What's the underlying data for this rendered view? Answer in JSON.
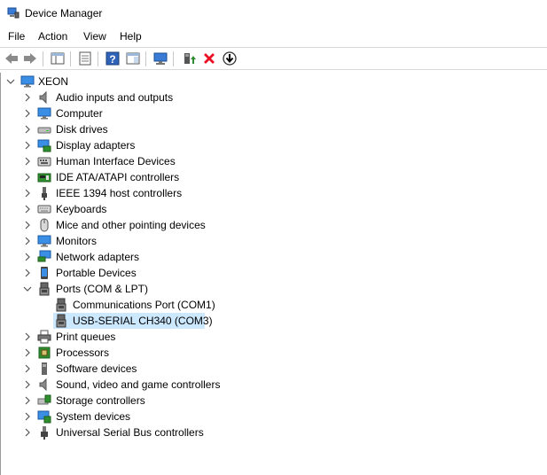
{
  "window": {
    "title": "Device Manager"
  },
  "menu": [
    "File",
    "Action",
    "View",
    "Help"
  ],
  "tree": {
    "root": "XEON",
    "categories": [
      {
        "label": "Audio inputs and outputs",
        "icon": "speaker-icon"
      },
      {
        "label": "Computer",
        "icon": "monitor-icon"
      },
      {
        "label": "Disk drives",
        "icon": "disk-drive-icon"
      },
      {
        "label": "Display adapters",
        "icon": "display-adapter-icon"
      },
      {
        "label": "Human Interface Devices",
        "icon": "hid-icon"
      },
      {
        "label": "IDE ATA/ATAPI controllers",
        "icon": "ide-controller-icon"
      },
      {
        "label": "IEEE 1394 host controllers",
        "icon": "ieee1394-icon"
      },
      {
        "label": "Keyboards",
        "icon": "keyboard-icon"
      },
      {
        "label": "Mice and other pointing devices",
        "icon": "mouse-icon"
      },
      {
        "label": "Monitors",
        "icon": "monitor-icon"
      },
      {
        "label": "Network adapters",
        "icon": "network-adapter-icon"
      },
      {
        "label": "Portable Devices",
        "icon": "portable-device-icon"
      },
      {
        "label": "Ports (COM & LPT)",
        "icon": "port-icon"
      },
      {
        "label": "Print queues",
        "icon": "printer-icon"
      },
      {
        "label": "Processors",
        "icon": "processor-icon"
      },
      {
        "label": "Software devices",
        "icon": "software-device-icon"
      },
      {
        "label": "Sound, video and game controllers",
        "icon": "sound-controller-icon"
      },
      {
        "label": "Storage controllers",
        "icon": "storage-controller-icon"
      },
      {
        "label": "System devices",
        "icon": "system-device-icon"
      },
      {
        "label": "Universal Serial Bus controllers",
        "icon": "usb-icon"
      }
    ],
    "ports_children": [
      {
        "label": "Communications Port (COM1)",
        "icon": "port-icon"
      },
      {
        "label": "USB-SERIAL CH340 (COM3)",
        "icon": "port-icon",
        "selected": true
      }
    ]
  },
  "colors": {
    "selection": "#cce8ff",
    "accent": "#1e73c8",
    "delete": "#e81123",
    "update": "#2e8b2e"
  }
}
